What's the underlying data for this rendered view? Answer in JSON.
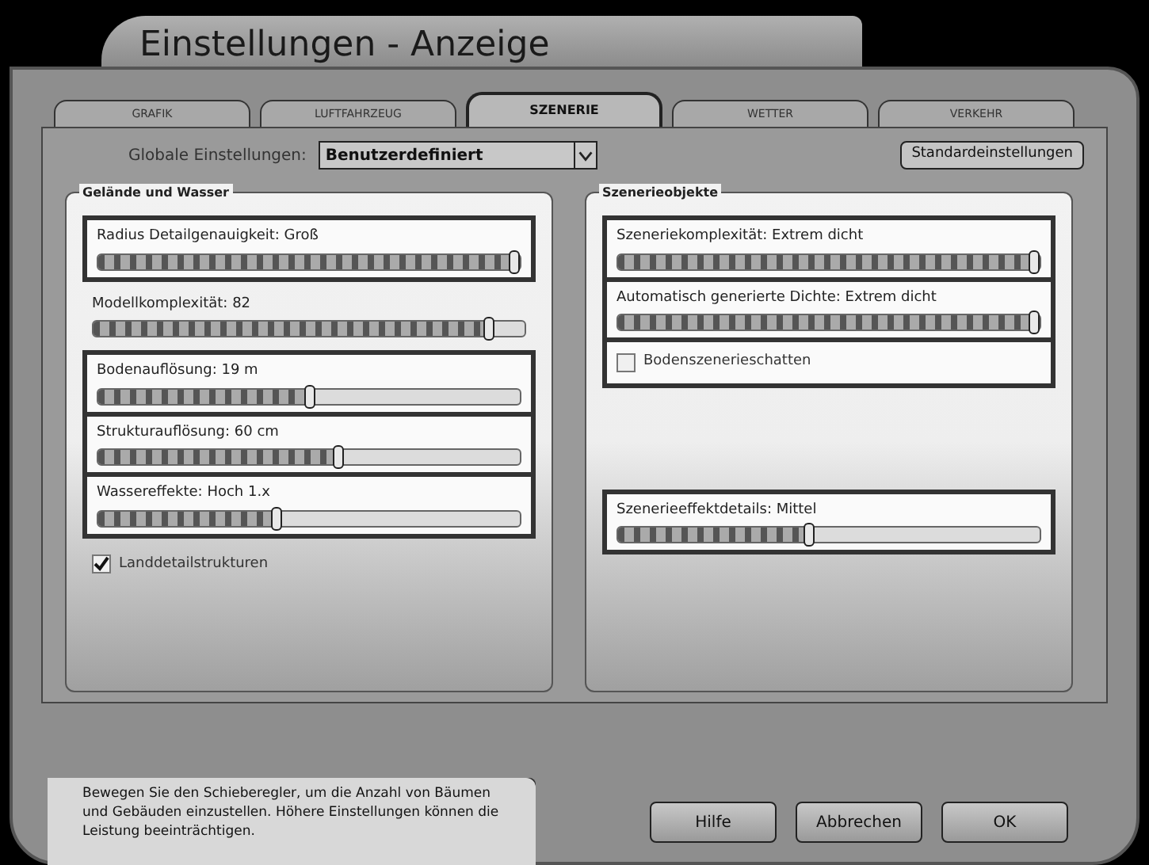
{
  "window": {
    "title": "Einstellungen - Anzeige"
  },
  "tabs": [
    {
      "label": "GRAFIK",
      "selected": false
    },
    {
      "label": "LUFTFAHRZEUG",
      "selected": false
    },
    {
      "label": "SZENERIE",
      "selected": true
    },
    {
      "label": "WETTER",
      "selected": false
    },
    {
      "label": "VERKEHR",
      "selected": false
    }
  ],
  "global_settings": {
    "label": "Globale Einstellungen:",
    "value": "Benutzerdefiniert",
    "reset_button": "Standardeinstellungen"
  },
  "groups": [
    {
      "title": "Gelände und Wasser",
      "blocks": [
        {
          "kind": "framed",
          "items": [
            {
              "kind": "slider",
              "label": "Radius Detailgenauigkeit: Groß",
              "level": 1
            }
          ]
        },
        {
          "kind": "plain",
          "items": [
            {
              "kind": "slider",
              "label": "Modellkomplexität: 82",
              "level": 0.93
            }
          ]
        },
        {
          "kind": "framed",
          "items": [
            {
              "kind": "slider",
              "label": "Bodenauflösung: 19 m",
              "level": 0.5
            },
            {
              "kind": "slider",
              "label": "Strukturauflösung: 60 cm",
              "level": 0.57
            },
            {
              "kind": "slider",
              "label": "Wassereffekte: Hoch 1.x",
              "level": 0.42
            }
          ]
        },
        {
          "kind": "plain",
          "items": [
            {
              "kind": "checkbox",
              "label": "Landdetailstrukturen",
              "checked": true
            }
          ]
        }
      ]
    },
    {
      "title": "Szenerieobjekte",
      "blocks": [
        {
          "kind": "framed",
          "items": [
            {
              "kind": "slider",
              "label": "Szeneriekomplexität: Extrem dicht",
              "level": 1
            },
            {
              "kind": "slider",
              "label": "Automatisch generierte Dichte: Extrem dicht",
              "level": 1
            },
            {
              "kind": "checkbox",
              "label": "Bodenszenerieschatten",
              "checked": false
            }
          ]
        },
        {
          "kind": "spacer"
        },
        {
          "kind": "framed",
          "items": [
            {
              "kind": "slider",
              "label": "Szenerieeffektdetails: Mittel",
              "level": 0.45
            }
          ]
        }
      ]
    }
  ],
  "help_text": "Bewegen Sie den Schieberegler, um die Anzahl von Bäumen und Gebäuden einzustellen. Höhere Einstellungen können die Leistung beeinträchtigen.",
  "buttons": [
    "Hilfe",
    "Abbrechen",
    "OK"
  ]
}
